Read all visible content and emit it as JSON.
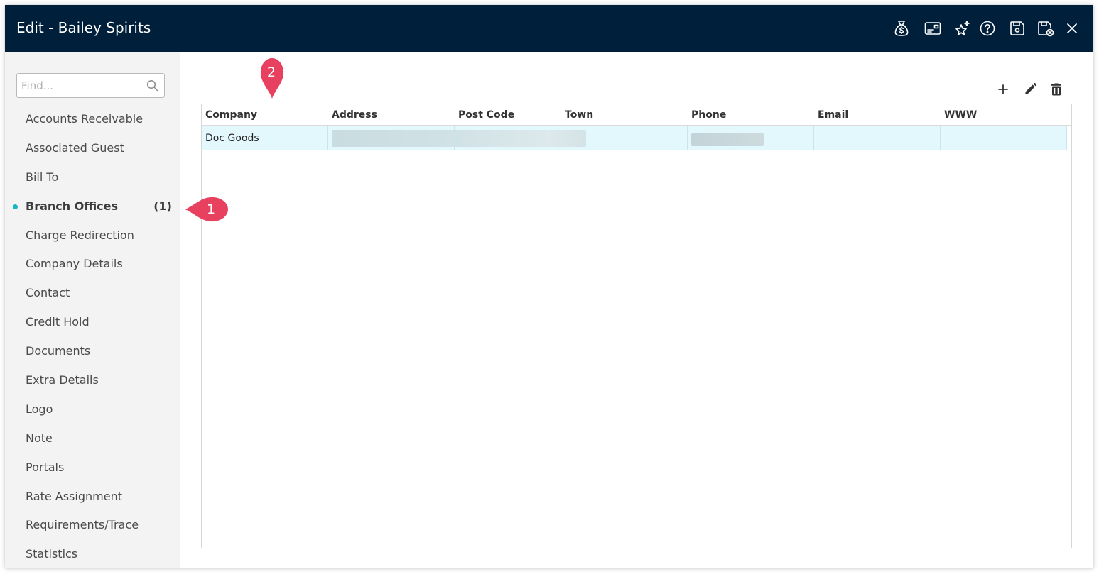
{
  "window": {
    "title": "Edit - Bailey Spirits",
    "header_color": "#001f3a"
  },
  "toolbar_icons": [
    "money-bag-icon",
    "card-icon",
    "sparkle-star-icon",
    "help-icon",
    "save-icon",
    "save-close-icon",
    "close-icon"
  ],
  "search": {
    "placeholder": "Find..."
  },
  "sidebar": {
    "accent_color": "#17b8c4",
    "items": [
      {
        "label": "Accounts Receivable"
      },
      {
        "label": "Associated Guest"
      },
      {
        "label": "Bill To"
      },
      {
        "label": "Branch Offices",
        "count": "(1)",
        "active": true
      },
      {
        "label": "Charge Redirection"
      },
      {
        "label": "Company Details"
      },
      {
        "label": "Contact"
      },
      {
        "label": "Credit Hold"
      },
      {
        "label": "Documents"
      },
      {
        "label": "Extra Details"
      },
      {
        "label": "Logo"
      },
      {
        "label": "Note"
      },
      {
        "label": "Portals"
      },
      {
        "label": "Rate Assignment"
      },
      {
        "label": "Requirements/Trace"
      },
      {
        "label": "Statistics"
      }
    ]
  },
  "grid_actions": [
    "add-icon",
    "edit-icon",
    "delete-icon"
  ],
  "grid": {
    "columns": [
      "Company",
      "Address",
      "Post Code",
      "Town",
      "Phone",
      "Email",
      "WWW"
    ],
    "rows": [
      {
        "company": "Doc Goods",
        "address": "",
        "post_code": "",
        "town": "",
        "phone": "",
        "email": "",
        "www": ""
      }
    ],
    "selected_row_color": "#e3f8fc"
  },
  "annotations": [
    {
      "number": "1",
      "color": "#e8405f"
    },
    {
      "number": "2",
      "color": "#e8405f"
    }
  ]
}
